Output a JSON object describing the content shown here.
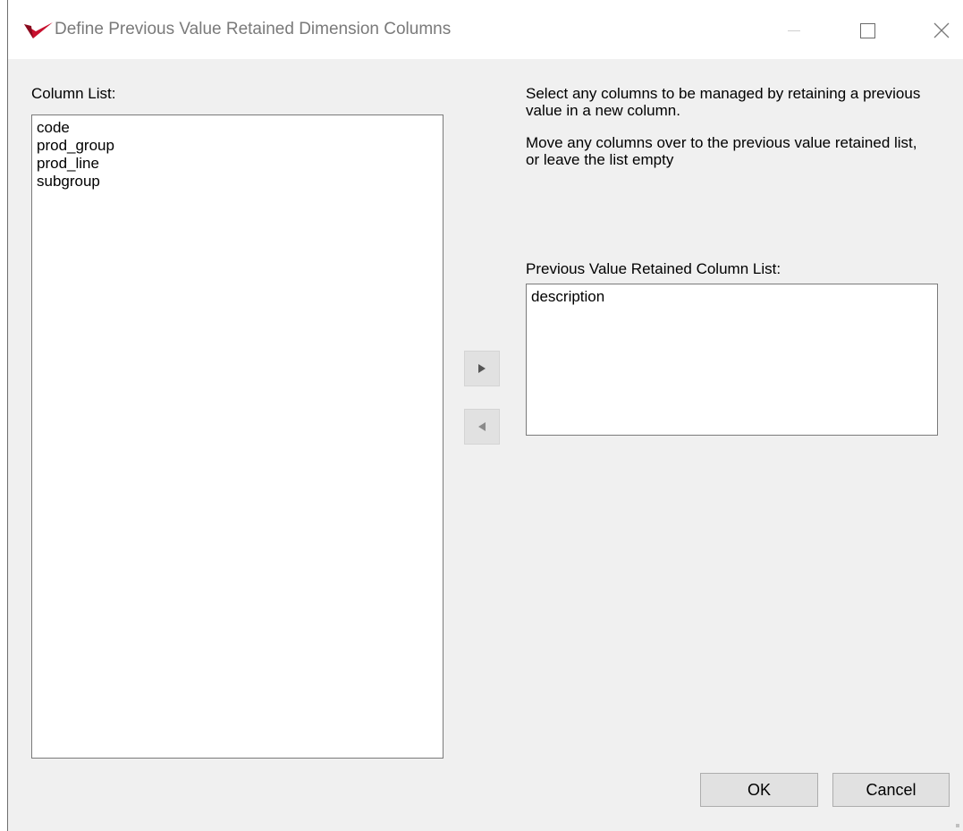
{
  "window": {
    "title": "Define Previous Value Retained Dimension Columns",
    "controls": {
      "minimize_icon": "minimize-icon",
      "maximize_icon": "maximize-icon",
      "close_icon": "close-icon"
    }
  },
  "column_list": {
    "label": "Column List:",
    "items": [
      "code",
      "prod_group",
      "prod_line",
      "subgroup"
    ]
  },
  "info": {
    "line1": "Select any columns to be managed by retaining a previous value in a new column.",
    "line2": "Move any columns over to the previous value retained list,",
    "line3": "or leave the list empty"
  },
  "retained_list": {
    "label": "Previous Value Retained Column List:",
    "items": [
      "description"
    ]
  },
  "move": {
    "right_icon": "triangle-right-icon",
    "left_icon": "triangle-left-icon"
  },
  "buttons": {
    "ok": "OK",
    "cancel": "Cancel"
  },
  "colors": {
    "window_bg": "#f0f0f0",
    "titlebar_bg": "#ffffff",
    "brand_red": "#c8102e",
    "title_text": "#7a7a7a"
  }
}
